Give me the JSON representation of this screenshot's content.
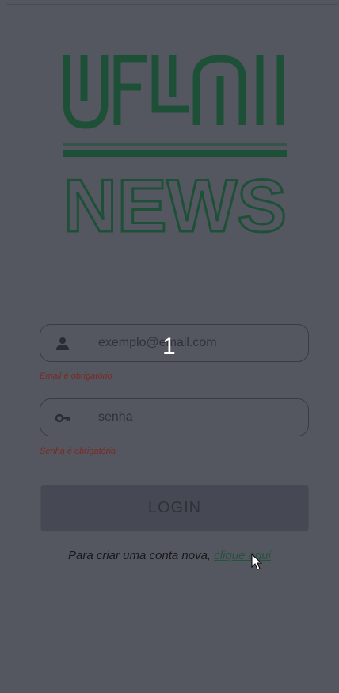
{
  "brand": {
    "line1": "UFLN",
    "line2": "NEWS",
    "color": "#1e5038"
  },
  "email": {
    "placeholder": "exemplo@email.com",
    "error": "Email é obrigatório",
    "icon": "person-icon"
  },
  "password": {
    "placeholder": "senha",
    "error": "Senha é obrigatória",
    "icon": "key-icon"
  },
  "overlay": {
    "label": "1"
  },
  "login": {
    "label": "LOGIN"
  },
  "signup": {
    "text": "Para criar uma conta nova, ",
    "link": "clique aqui"
  }
}
